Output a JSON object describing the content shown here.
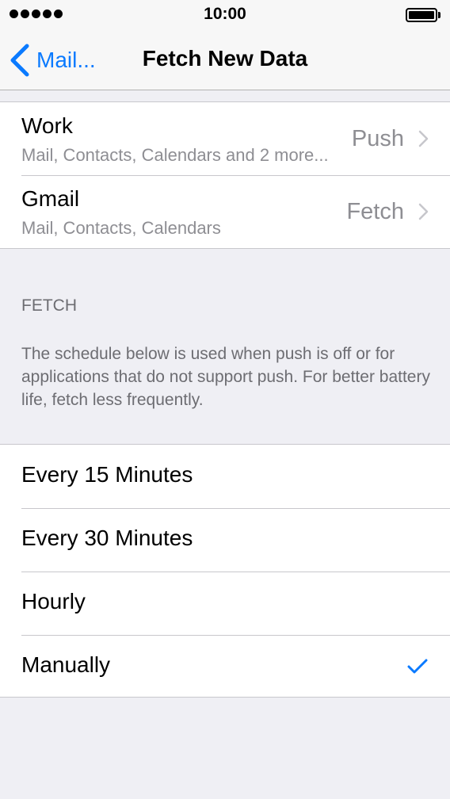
{
  "status_bar": {
    "time": "10:00",
    "signal_dots": 5,
    "battery_level": 1.0
  },
  "nav": {
    "back_label": "Mail...",
    "title": "Fetch New Data"
  },
  "accounts": [
    {
      "name": "Work",
      "services": "Mail, Contacts, Calendars and 2 more...",
      "mode": "Push"
    },
    {
      "name": "Gmail",
      "services": "Mail, Contacts, Calendars",
      "mode": "Fetch"
    }
  ],
  "fetch_section": {
    "header": "FETCH",
    "description": "The schedule below is used when push is off or for applications that do not support push. For better battery life, fetch less frequently.",
    "options": [
      {
        "label": "Every 15 Minutes",
        "selected": false
      },
      {
        "label": "Every 30 Minutes",
        "selected": false
      },
      {
        "label": "Hourly",
        "selected": false
      },
      {
        "label": "Manually",
        "selected": true
      }
    ]
  },
  "colors": {
    "accent": "#0a7aff",
    "background": "#efeff4",
    "secondary_text": "#8e8e93",
    "separator": "#c8c7cc"
  },
  "icons": {
    "back": "chevron-left-icon",
    "disclosure": "chevron-right-icon",
    "selected": "checkmark-icon"
  }
}
